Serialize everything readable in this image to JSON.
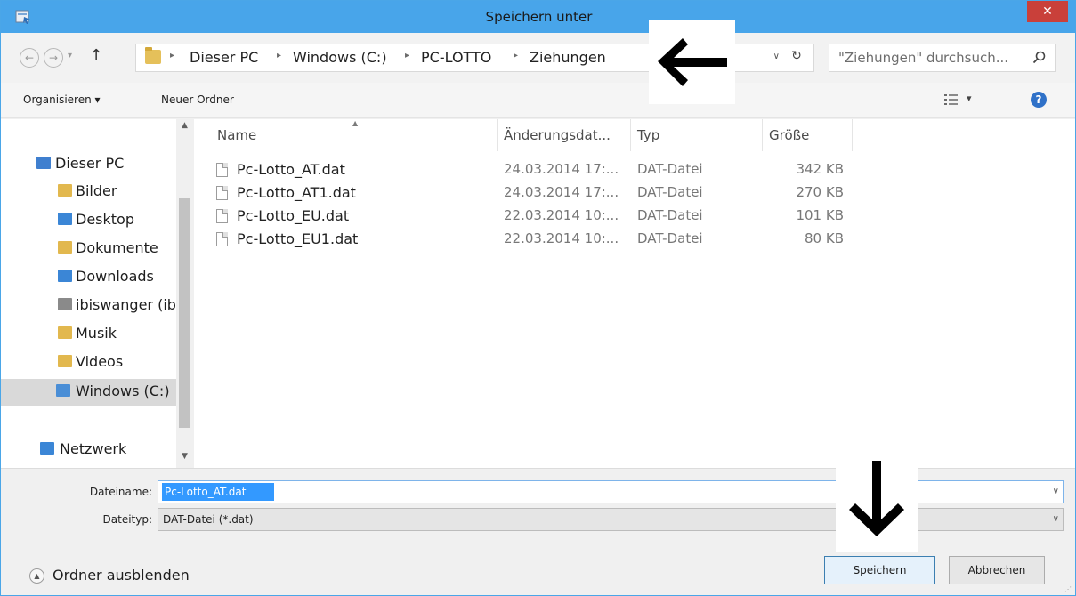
{
  "window": {
    "title": "Speichern unter",
    "close_label": "✕"
  },
  "nav": {
    "back_label": "←",
    "forward_label": "→",
    "recent_label": "▾",
    "up_label": "↑",
    "address": {
      "crumbs": [
        "Dieser PC",
        "Windows (C:)",
        "PC-LOTTO",
        "Ziehungen"
      ],
      "separator": "▸",
      "dropdown_label": "∨",
      "refresh_label": "↻"
    },
    "search": {
      "placeholder": "\"Ziehungen\" durchsuch..."
    }
  },
  "toolbar": {
    "organize_label": "Organisieren ▾",
    "new_folder_label": "Neuer Ordner",
    "view_label": "▾",
    "help_label": "?"
  },
  "sidebar": {
    "items": [
      {
        "label": "Dieser PC",
        "icon": "computer-icon",
        "color": "#3f7fcf"
      },
      {
        "label": "Bilder",
        "icon": "pictures-folder-icon",
        "color": "#e2b84e"
      },
      {
        "label": "Desktop",
        "icon": "desktop-folder-icon",
        "color": "#3b86d6"
      },
      {
        "label": "Dokumente",
        "icon": "documents-folder-icon",
        "color": "#e2b84e"
      },
      {
        "label": "Downloads",
        "icon": "downloads-folder-icon",
        "color": "#3b86d6"
      },
      {
        "label": "ibiswanger (ib",
        "icon": "network-drive-icon",
        "color": "#8a8a8a"
      },
      {
        "label": "Musik",
        "icon": "music-folder-icon",
        "color": "#e2b84e"
      },
      {
        "label": "Videos",
        "icon": "videos-folder-icon",
        "color": "#e2b84e"
      },
      {
        "label": "Windows (C:)",
        "icon": "drive-icon",
        "color": "#4a8ed6"
      },
      {
        "label": "Netzwerk",
        "icon": "network-icon",
        "color": "#3b86d6"
      }
    ],
    "scroll_up": "▲",
    "scroll_down": "▼"
  },
  "filelist": {
    "columns": {
      "name": "Name",
      "modified": "Änderungsdat...",
      "type": "Typ",
      "size": "Größe"
    },
    "sort_indicator": "▲",
    "rows": [
      {
        "name": "Pc-Lotto_AT.dat",
        "modified": "24.03.2014 17:...",
        "type": "DAT-Datei",
        "size": "342 KB"
      },
      {
        "name": "Pc-Lotto_AT1.dat",
        "modified": "24.03.2014 17:...",
        "type": "DAT-Datei",
        "size": "270 KB"
      },
      {
        "name": "Pc-Lotto_EU.dat",
        "modified": "22.03.2014 10:...",
        "type": "DAT-Datei",
        "size": "101 KB"
      },
      {
        "name": "Pc-Lotto_EU1.dat",
        "modified": "22.03.2014 10:...",
        "type": "DAT-Datei",
        "size": "80 KB"
      }
    ]
  },
  "bottom": {
    "filename_label": "Dateiname:",
    "filename_value": "Pc-Lotto_AT.dat",
    "filetype_label": "Dateityp:",
    "filetype_value": "DAT-Datei (*.dat)",
    "dropdown_label": "∨",
    "hide_folders_label": "Ordner ausblenden",
    "hide_folders_icon": "▲",
    "save_label": "Speichern",
    "cancel_label": "Abbrechen"
  },
  "colors": {
    "titlebar": "#48a5ea",
    "close": "#c9403a",
    "selection": "#3399ff",
    "annotation_arrow": "#000000"
  }
}
